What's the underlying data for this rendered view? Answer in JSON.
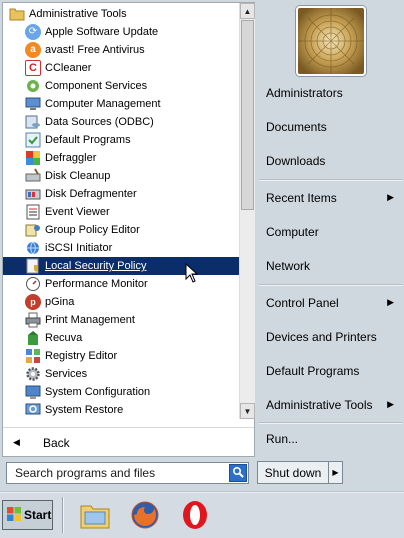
{
  "programs": {
    "folder": {
      "label": "Administrative Tools",
      "icon": "folder-icon"
    },
    "items": [
      {
        "label": "Apple Software Update",
        "icon": "apple-software-update-icon"
      },
      {
        "label": "avast! Free Antivirus",
        "icon": "avast-icon"
      },
      {
        "label": "CCleaner",
        "icon": "ccleaner-icon"
      },
      {
        "label": "Component Services",
        "icon": "component-services-icon"
      },
      {
        "label": "Computer Management",
        "icon": "computer-management-icon"
      },
      {
        "label": "Data Sources (ODBC)",
        "icon": "data-sources-icon"
      },
      {
        "label": "Default Programs",
        "icon": "default-programs-icon"
      },
      {
        "label": "Defraggler",
        "icon": "defraggler-icon"
      },
      {
        "label": "Disk Cleanup",
        "icon": "disk-cleanup-icon"
      },
      {
        "label": "Disk Defragmenter",
        "icon": "disk-defragmenter-icon"
      },
      {
        "label": "Event Viewer",
        "icon": "event-viewer-icon"
      },
      {
        "label": "Group Policy Editor",
        "icon": "group-policy-editor-icon"
      },
      {
        "label": "iSCSI Initiator",
        "icon": "iscsi-initiator-icon"
      },
      {
        "label": "Local Security Policy",
        "icon": "local-security-policy-icon"
      },
      {
        "label": "Performance Monitor",
        "icon": "performance-monitor-icon"
      },
      {
        "label": "pGina",
        "icon": "pgina-icon"
      },
      {
        "label": "Print Management",
        "icon": "print-management-icon"
      },
      {
        "label": "Recuva",
        "icon": "recuva-icon"
      },
      {
        "label": "Registry Editor",
        "icon": "registry-editor-icon"
      },
      {
        "label": "Services",
        "icon": "services-icon"
      },
      {
        "label": "System Configuration",
        "icon": "system-configuration-icon"
      },
      {
        "label": "System Restore",
        "icon": "system-restore-icon"
      }
    ],
    "selected_label": "Local Security Policy"
  },
  "back": {
    "label": "Back",
    "icon": "left-arrow-icon"
  },
  "search": {
    "placeholder": "Search programs and files",
    "icon": "search-icon"
  },
  "right_panel": {
    "items": [
      {
        "label": "Administrators",
        "has_arrow": false
      },
      {
        "label": "Documents",
        "has_arrow": false
      },
      {
        "label": "Downloads",
        "has_arrow": false
      },
      {
        "label": "Recent Items",
        "has_arrow": true
      },
      {
        "label": "Computer",
        "has_arrow": false
      },
      {
        "label": "Network",
        "has_arrow": false
      },
      {
        "label": "Control Panel",
        "has_arrow": true
      },
      {
        "label": "Devices and Printers",
        "has_arrow": false
      },
      {
        "label": "Default Programs",
        "has_arrow": false
      },
      {
        "label": "Administrative Tools",
        "has_arrow": true
      },
      {
        "label": "Run...",
        "has_arrow": false
      }
    ]
  },
  "shutdown": {
    "label": "Shut down"
  },
  "taskbar": {
    "start_label": "Start",
    "pinned": [
      {
        "name": "windows-explorer-icon"
      },
      {
        "name": "firefox-icon"
      },
      {
        "name": "opera-icon"
      }
    ]
  },
  "colors": {
    "selection": "#0b2d69",
    "frame": "#cfd7df",
    "taskbar": "#d4dbe2"
  }
}
